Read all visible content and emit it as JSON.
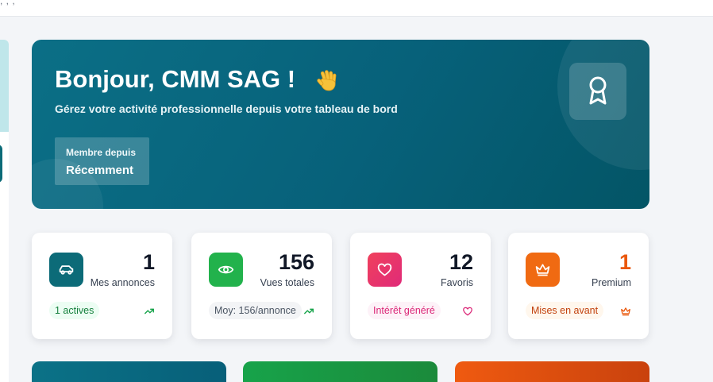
{
  "hero": {
    "title": "Bonjour, CMM SAG !",
    "subtitle": "Gérez votre activité professionnelle depuis votre tableau de bord",
    "member_label": "Membre depuis",
    "member_value": "Récemment"
  },
  "stats": [
    {
      "value": "1",
      "label": "Mes annonces",
      "pill": "1 actives",
      "icon": "car-icon",
      "trail_icon": "trend-up-icon",
      "accent": "#0c6b78"
    },
    {
      "value": "156",
      "label": "Vues totales",
      "pill": "Moy: 156/annonce",
      "icon": "eye-icon",
      "trail_icon": "trend-up-icon",
      "accent": "#22b24c"
    },
    {
      "value": "12",
      "label": "Favoris",
      "pill": "Intérêt généré",
      "icon": "heart-icon",
      "trail_icon": "heart-icon",
      "accent": "#e8346a"
    },
    {
      "value": "1",
      "label": "Premium",
      "pill": "Mises en avant",
      "icon": "crown-icon",
      "trail_icon": "crown-icon",
      "accent": "#f06a12"
    }
  ],
  "colors": {
    "hero_start": "#0b6f86",
    "hero_end": "#035566",
    "premium_value": "#ea580c",
    "green": "#16a34a",
    "pink": "#db2777",
    "orange": "#ea580c"
  }
}
